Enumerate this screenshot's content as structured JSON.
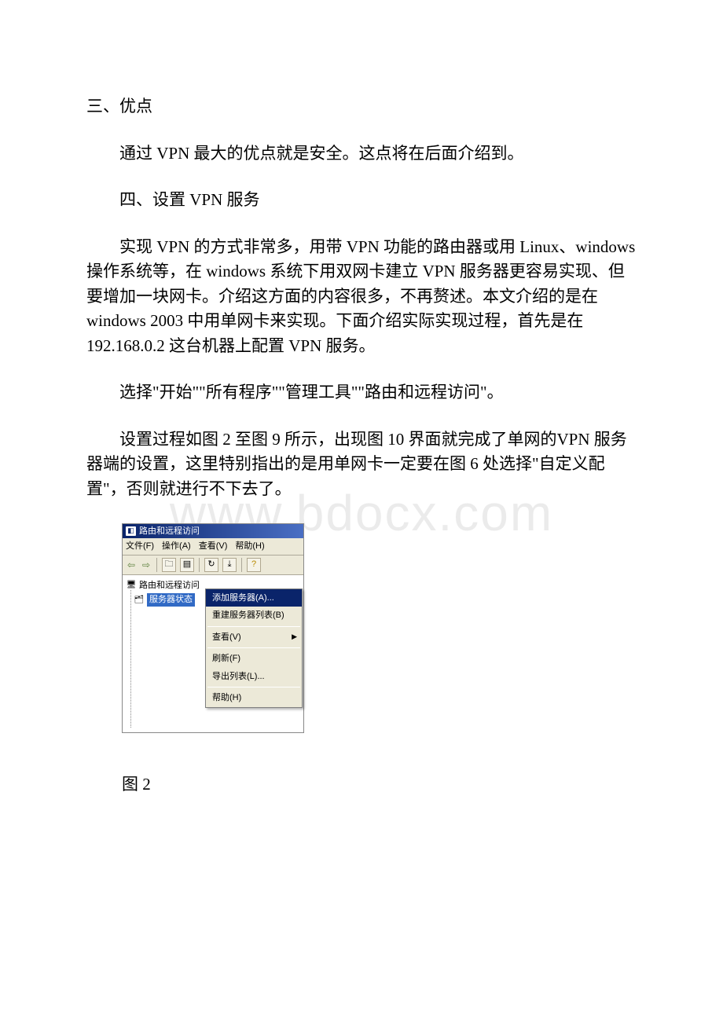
{
  "watermark": "www.bdocx.com",
  "doc": {
    "h1": "三、优点",
    "p1": "通过 VPN 最大的优点就是安全。这点将在后面介绍到。",
    "h2": "四、设置 VPN 服务",
    "p2": "实现 VPN 的方式非常多，用带 VPN 功能的路由器或用 Linux、windows 操作系统等，在 windows 系统下用双网卡建立 VPN 服务器更容易实现、但要增加一块网卡。介绍这方面的内容很多，不再赘述。本文介绍的是在 windows 2003 中用单网卡来实现。下面介绍实际实现过程，首先是在 192.168.0.2 这台机器上配置 VPN 服务。",
    "p3": "选择\"开始\"\"所有程序\"\"管理工具\"\"路由和远程访问\"。",
    "p4": "设置过程如图 2 至图 9 所示，出现图 10 界面就完成了单网的VPN 服务器端的设置，这里特别指出的是用单网卡一定要在图 6 处选择\"自定义配置\"，否则就进行不下去了。",
    "caption": "图 2"
  },
  "win": {
    "title": "路由和远程访问",
    "menu": {
      "file": "文件(F)",
      "action": "操作(A)",
      "view": "查看(V)",
      "help": "帮助(H)"
    },
    "tree": {
      "root": "路由和远程访问",
      "node1": "服务器状态"
    },
    "ctx": {
      "add": "添加服务器(A)...",
      "rebuild": "重建服务器列表(B)",
      "view": "查看(V)",
      "refresh": "刷新(F)",
      "export": "导出列表(L)...",
      "help": "帮助(H)"
    },
    "icons": {
      "back": "back-arrow-icon",
      "forward": "forward-arrow-icon",
      "up": "up-folder-icon",
      "props": "properties-icon",
      "refresh": "refresh-icon",
      "export": "export-icon",
      "help2": "help-icon"
    }
  }
}
